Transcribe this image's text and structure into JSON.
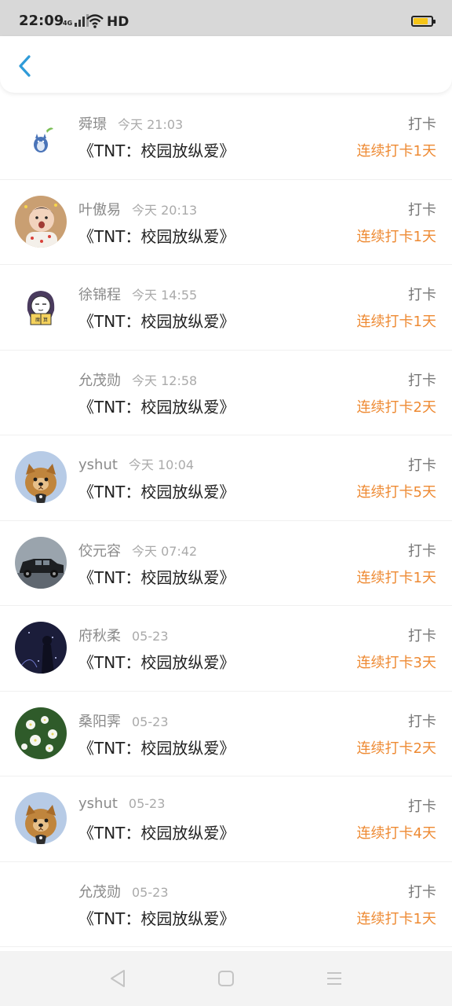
{
  "status_bar": {
    "time": "22:09",
    "network": "4G",
    "hd": "HD"
  },
  "header": {
    "back_icon": "chevron-left-icon"
  },
  "colors": {
    "accent_blue": "#2f9bd8",
    "streak_orange": "#ee8a33"
  },
  "records": [
    {
      "name": "舜璟",
      "time": "今天 21:03",
      "title": "《TNT：校园放纵爱》",
      "action": "打卡",
      "streak": "连续打卡1天",
      "avatar": "totoro"
    },
    {
      "name": "叶傲易",
      "time": "今天 20:13",
      "title": "《TNT：校园放纵爱》",
      "action": "打卡",
      "streak": "连续打卡1天",
      "avatar": "baby"
    },
    {
      "name": "徐锦程",
      "time": "今天 14:55",
      "title": "《TNT：校园放纵爱》",
      "action": "打卡",
      "streak": "连续打卡1天",
      "avatar": "cartoon-girl"
    },
    {
      "name": "允茂勋",
      "time": "今天 12:58",
      "title": "《TNT：校园放纵爱》",
      "action": "打卡",
      "streak": "连续打卡2天",
      "avatar": "none"
    },
    {
      "name": "yshut",
      "time": "今天 10:04",
      "title": "《TNT：校园放纵爱》",
      "action": "打卡",
      "streak": "连续打卡5天",
      "avatar": "dog"
    },
    {
      "name": "佼元容",
      "time": "今天 07:42",
      "title": "《TNT：校园放纵爱》",
      "action": "打卡",
      "streak": "连续打卡1天",
      "avatar": "car"
    },
    {
      "name": "府秋柔",
      "time": "05-23",
      "title": "《TNT：校园放纵爱》",
      "action": "打卡",
      "streak": "连续打卡3天",
      "avatar": "night"
    },
    {
      "name": "桑阳霁",
      "time": "05-23",
      "title": "《TNT：校园放纵爱》",
      "action": "打卡",
      "streak": "连续打卡2天",
      "avatar": "flowers"
    },
    {
      "name": "yshut",
      "time": "05-23",
      "title": "《TNT：校园放纵爱》",
      "action": "打卡",
      "streak": "连续打卡4天",
      "avatar": "dog"
    },
    {
      "name": "允茂勋",
      "time": "05-23",
      "title": "《TNT：校园放纵爱》",
      "action": "打卡",
      "streak": "连续打卡1天",
      "avatar": "none"
    }
  ],
  "nav_bar": {
    "back": "nav-back-icon",
    "home": "nav-home-icon",
    "menu": "nav-menu-icon"
  }
}
